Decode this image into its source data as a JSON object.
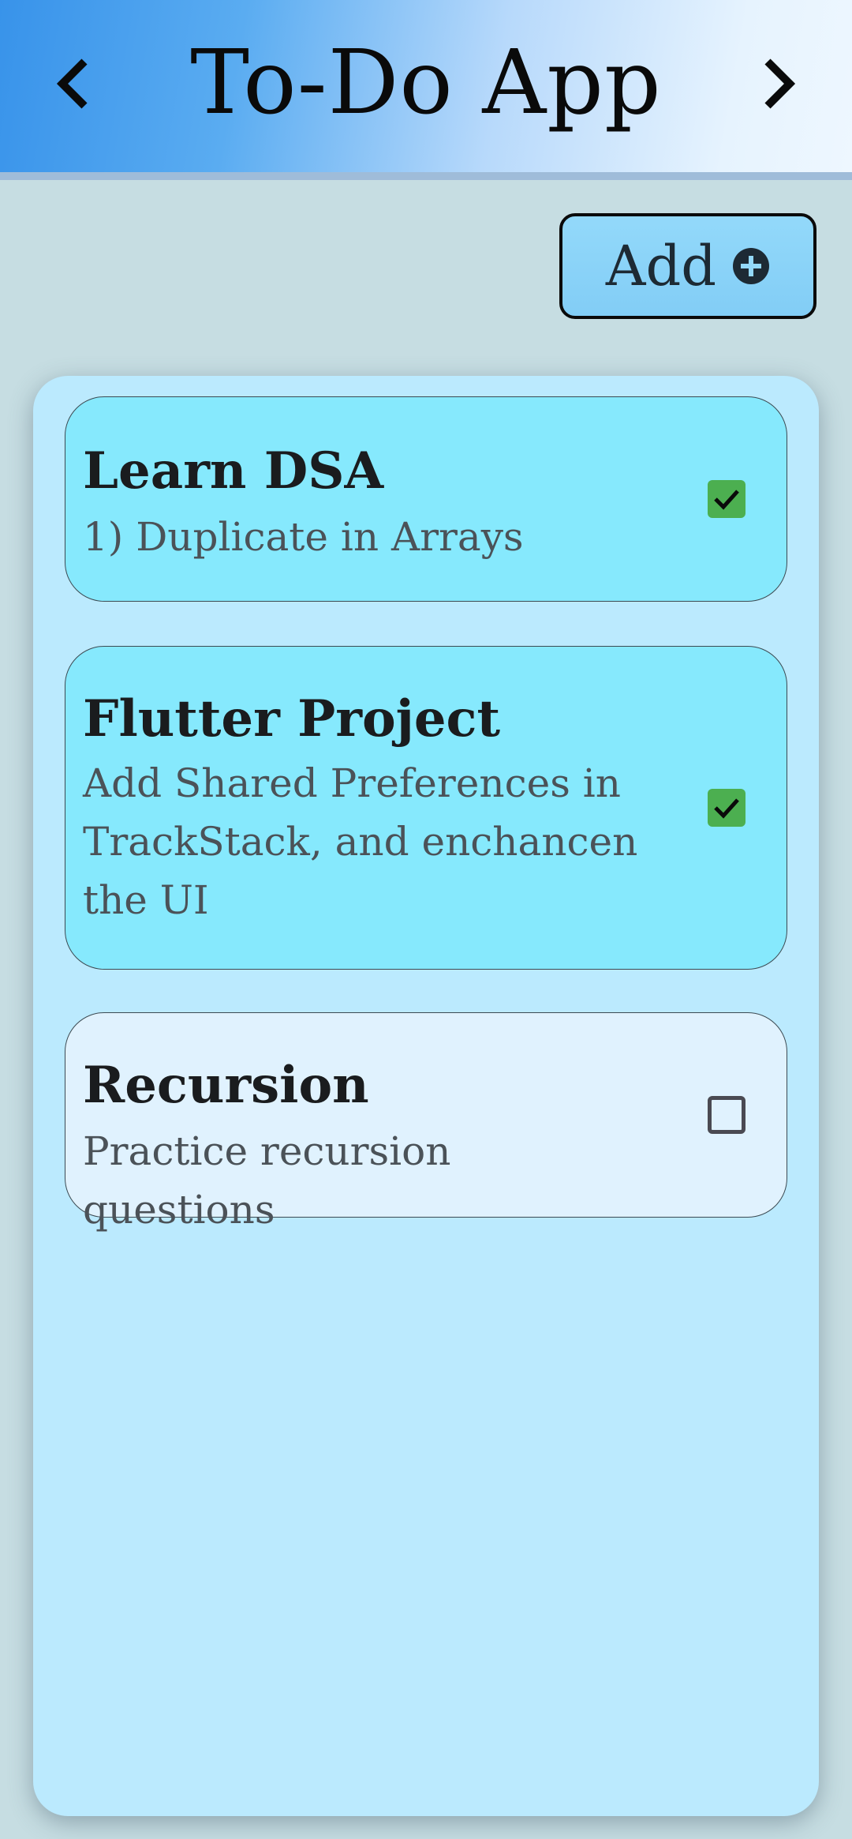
{
  "app_bar": {
    "title": "To-Do App",
    "back_icon": "chevron-left-icon",
    "forward_icon": "chevron-right-icon"
  },
  "toolbar": {
    "add_label": "Add",
    "add_icon": "plus-circle-icon"
  },
  "tasks": [
    {
      "title": "Learn DSA",
      "description": "1) Duplicate in Arrays",
      "completed": true
    },
    {
      "title": "Flutter Project",
      "description": "Add Shared Preferences in TrackStack, and enchancen the UI",
      "completed": true
    },
    {
      "title": "Recursion",
      "description": "Practice recursion questions",
      "completed": false
    }
  ],
  "colors": {
    "completed_card": "#86e9fd",
    "pending_card": "#e0f2fe",
    "checkbox_checked": "#4caf50",
    "panel": "#bbeafe",
    "background": "#c6dde2"
  }
}
